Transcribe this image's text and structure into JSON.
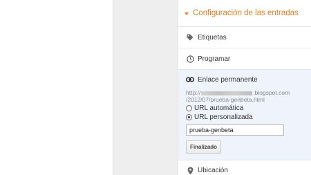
{
  "settings": {
    "title": "Configuración de las entradas",
    "items": [
      {
        "label": "Etiquetas",
        "icon": "tag-icon"
      },
      {
        "label": "Programar",
        "icon": "clock-icon"
      }
    ],
    "permalink": {
      "label": "Enlace permanente",
      "icon": "link-icon",
      "url_prefix": "http://",
      "url_domain_suffix": ".blogspot.com",
      "url_path": "/2012/07/prueba-genbeta.html",
      "options": [
        {
          "label": "URL automática",
          "checked": false
        },
        {
          "label": "URL personalizada",
          "checked": true
        }
      ],
      "custom_url_value": "prueba-genbeta",
      "done_label": "Finalizado"
    },
    "location": {
      "label": "Ubicación",
      "icon": "map-pin-icon"
    }
  },
  "colors": {
    "accent": "#e67e22",
    "expanded_bg": "#eef3fc"
  }
}
